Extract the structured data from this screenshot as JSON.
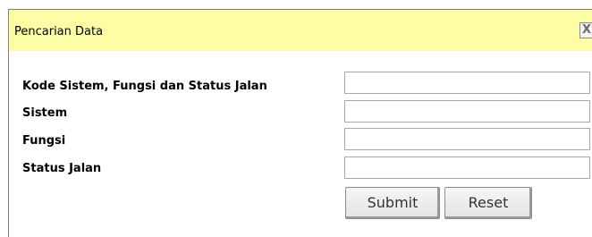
{
  "dialog": {
    "title": "Pencarian Data",
    "close_label": "X"
  },
  "form": {
    "fields": [
      {
        "label": "Kode Sistem, Fungsi dan Status Jalan",
        "value": ""
      },
      {
        "label": "Sistem",
        "value": ""
      },
      {
        "label": "Fungsi",
        "value": ""
      },
      {
        "label": "Status Jalan",
        "value": ""
      }
    ],
    "submit_label": "Submit",
    "reset_label": "Reset"
  },
  "colors": {
    "titlebar_bg": "#fdfda6"
  }
}
